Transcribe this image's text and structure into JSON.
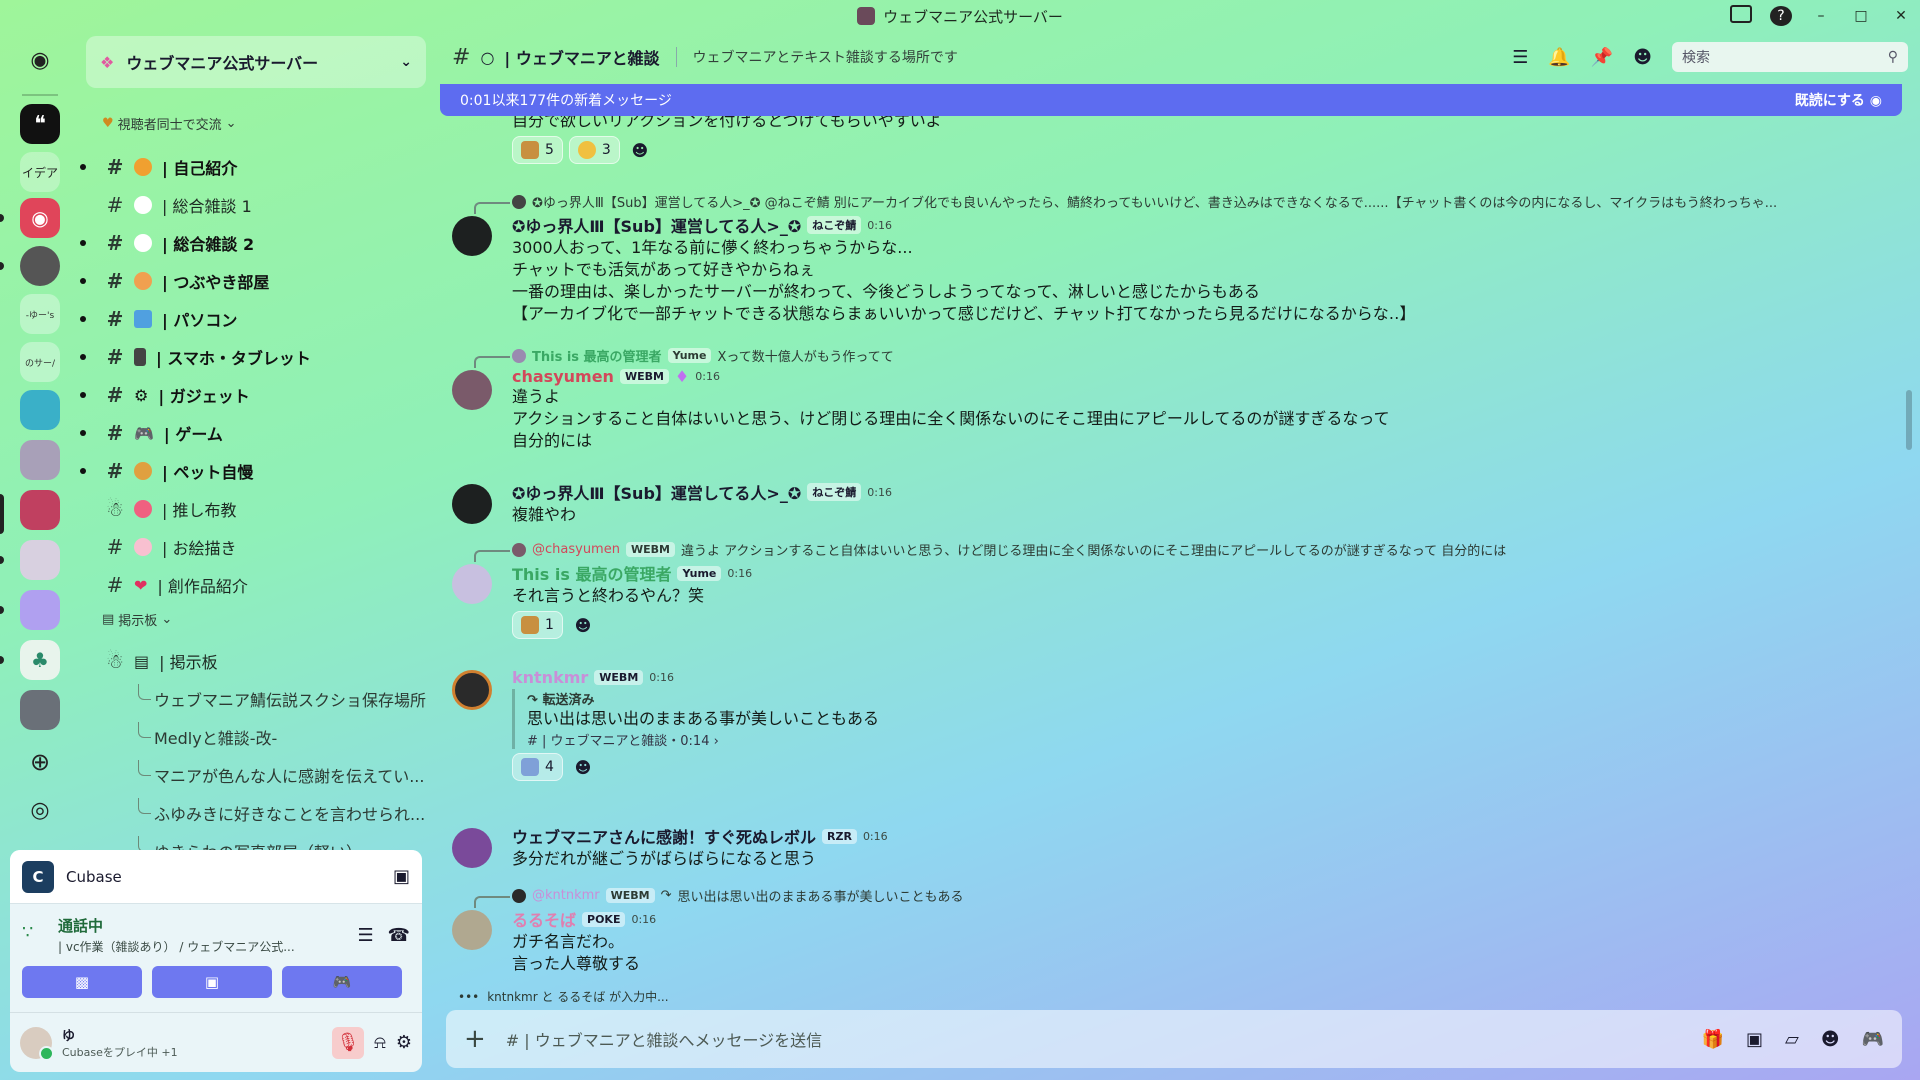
{
  "window": {
    "title": "ウェブマニア公式サーバー"
  },
  "server": {
    "name": "ウェブマニア公式サーバー"
  },
  "rail": {
    "idea_label": "イデア"
  },
  "sidebar": {
    "category1": "視聴者同士で交流",
    "channels": [
      {
        "label": "| 自己紹介",
        "bold": true
      },
      {
        "label": "| 総合雑談 1",
        "bold": false
      },
      {
        "label": "| 総合雑談 2",
        "bold": true
      },
      {
        "label": "| つぶやき部屋",
        "bold": true
      },
      {
        "label": "| パソコン",
        "bold": true
      },
      {
        "label": "| スマホ・タブレット",
        "bold": true
      },
      {
        "label": "| ガジェット",
        "bold": true
      },
      {
        "label": "| ゲーム",
        "bold": true
      },
      {
        "label": "| ペット自慢",
        "bold": true
      },
      {
        "label": "| 推し布教",
        "bold": false
      },
      {
        "label": "| お絵描き",
        "bold": false
      },
      {
        "label": "| 創作品紹介",
        "bold": false
      }
    ],
    "category2": "掲示板",
    "forum": "| 掲示板",
    "threads": [
      "ウェブマニア鯖伝説スクショ保存場所",
      "Medlyと雑談-改-",
      "マニアが色んな人に感謝を伝えてい...",
      "ふゆみきに好きなことを言わせられ...",
      "ゆきらわの写真部屋（軽い）"
    ]
  },
  "activity": {
    "app": "Cubase"
  },
  "voice": {
    "status": "通話中",
    "channel": "| vc作業（雑談あり） / ウェブマニア公式..."
  },
  "user": {
    "name": "ゆ",
    "status": "Cubaseをプレイ中 +1"
  },
  "header": {
    "channel": "| ウェブマニアと雑談",
    "topic": "ウェブマニアとテキスト雑談する場所です",
    "search_placeholder": "検索"
  },
  "newbar": {
    "text": "0:01以来177件の新着メッセージ",
    "mark_read": "既読にする"
  },
  "messages": {
    "m0": {
      "line": "自分で欲しいリアクションを付けるとつけてもらいやすいよ",
      "r1": "5",
      "r2": "3"
    },
    "m1": {
      "reply": "✪ゆっ界人Ⅲ【Sub】運営してる人>_✪ @ねこぞ鯖 別にアーカイブ化でも良いんやったら、鯖終わってもいいけど、書き込みはできなくなるで......【チャット書くのは今の内になるし、マイクラはもう終わっちゃ...",
      "author": "✪ゆっ界人Ⅲ【Sub】運営してる人>_✪",
      "tag": "ねこぞ鯖",
      "time": "0:16",
      "lines": [
        "3000人おって、1年なる前に儚く終わっちゃうからな...",
        "チャットでも活気があって好きやからねぇ",
        "一番の理由は、楽しかったサーバーが終わって、今後どうしようってなって、淋しいと感じたからもある",
        "【アーカイブ化で一部チャットできる状態ならまぁいいかって感じだけど、チャット打てなかったら見るだけになるからな‥】"
      ]
    },
    "m2": {
      "reply_author": "This is 最高の管理者",
      "reply_tag": "Yume",
      "reply_text": "Xって数十億人がもう作ってて",
      "author": "chasyumen",
      "tag": "WEBM",
      "time": "0:16",
      "lines": [
        "違うよ",
        "アクションすること自体はいいと思う、けど閉じる理由に全く関係ないのにそこ理由にアピールしてるのが謎すぎるなって",
        "自分的には"
      ]
    },
    "m3": {
      "author": "✪ゆっ界人Ⅲ【Sub】運営してる人>_✪",
      "tag": "ねこぞ鯖",
      "time": "0:16",
      "line": "複雑やわ"
    },
    "m4": {
      "reply_author": "@chasyumen",
      "reply_tag": "WEBM",
      "reply_text": "違うよ アクションすること自体はいいと思う、けど閉じる理由に全く関係ないのにそこ理由にアピールしてるのが謎すぎるなって 自分的には",
      "author": "This is 最高の管理者",
      "tag": "Yume",
      "time": "0:16",
      "line": "それ言うと終わるやん？笑",
      "r1": "1"
    },
    "m5": {
      "author": "kntnkmr",
      "tag": "WEBM",
      "time": "0:16",
      "fwd_label": "転送済み",
      "fwd_text": "思い出は思い出のままある事が美しいこともある",
      "fwd_src": "# | ウェブマニアと雑談・0:14 ›",
      "r1": "4"
    },
    "m6": {
      "author": "ウェブマニアさんに感謝！すぐ死ぬレボル",
      "tag": "RZR",
      "time": "0:16",
      "line": "多分だれが継ごうがばらばらになると思う"
    },
    "m7": {
      "reply_author": "@kntnkmr",
      "reply_tag": "WEBM",
      "reply_text": "思い出は思い出のままある事が美しいこともある",
      "author": "るるそば",
      "tag": "POKE",
      "time": "0:16",
      "lines": [
        "ガチ名言だわ。",
        "言った人尊敬する"
      ]
    }
  },
  "typing": {
    "text": "kntnkmr と るるそば が入力中..."
  },
  "composer": {
    "placeholder": "# | ウェブマニアと雑談へメッセージを送信"
  },
  "colors": {
    "accent": "#5d6cf0",
    "chasyumen": "#d2485a",
    "admin": "#3aa864",
    "kntnkmr": "#c88fd8",
    "rurusoba": "#e07fb0"
  }
}
